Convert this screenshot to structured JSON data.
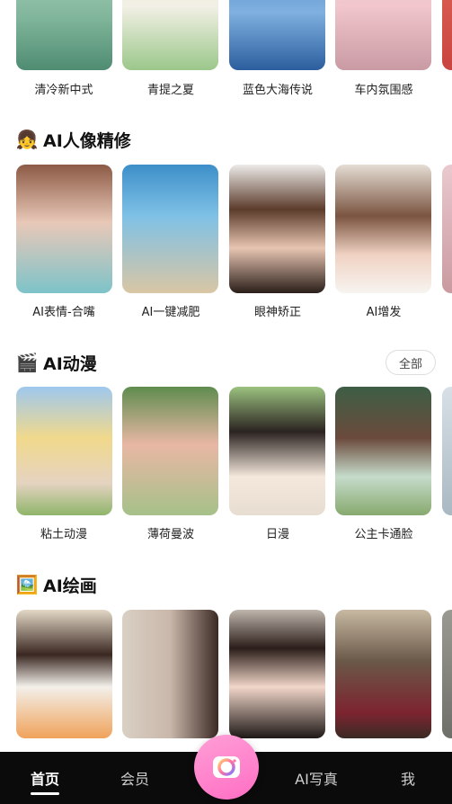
{
  "sections": [
    {
      "title": "",
      "cards": [
        {
          "label": "清冷新中式",
          "gradient": "linear-gradient(180deg,#b9d9c8 0%,#7fb59a 60%,#4f8c72 100%)"
        },
        {
          "label": "青提之夏",
          "gradient": "linear-gradient(180deg,#cfe7b5 0%,#f3f0e6 50%,#9bc78a 100%)"
        },
        {
          "label": "蓝色大海传说",
          "gradient": "linear-gradient(180deg,#4a7fc1 0%,#7fb0e0 55%,#2c5e9e 100%)"
        },
        {
          "label": "车内氛围感",
          "gradient": "linear-gradient(180deg,#e9d3cf 0%,#f1c6cc 50%,#c99aa3 100%)"
        }
      ]
    },
    {
      "title": "AI人像精修",
      "emoji": "👧",
      "cards": [
        {
          "label": "AI表情-合嘴",
          "gradient": "linear-gradient(180deg,#8c5a45 0%,#e9c8b8 45%,#7dc3c9 100%)"
        },
        {
          "label": "AI一键减肥",
          "gradient": "linear-gradient(180deg,#3d8fc9 0%,#7fc1e6 40%,#d9c6a4 100%)"
        },
        {
          "label": "眼神矫正",
          "gradient": "linear-gradient(180deg,#eceae8 0%,#5b3b2a 35%,#e7c5b2 65%,#2a1e19 100%)"
        },
        {
          "label": "AI增发",
          "gradient": "linear-gradient(180deg,#e5ddd4 0%,#7a5440 40%,#f0d2c3 70%,#f7f4f0 100%)"
        }
      ]
    },
    {
      "title": "AI动漫",
      "emoji": "🎬",
      "all_label": "全部",
      "cards": [
        {
          "label": "粘土动漫",
          "gradient": "linear-gradient(180deg,#9fc8ee 0%,#f1d98c 40%,#e5d3c1 75%,#8fb56a 100%)"
        },
        {
          "label": "薄荷曼波",
          "gradient": "linear-gradient(180deg,#5f8c4e 0%,#e8b7a4 45%,#a6c189 100%)"
        },
        {
          "label": "日漫",
          "gradient": "linear-gradient(180deg,#9bc27f 0%,#2b2321 35%,#f4e8dc 70%,#e7ddd0 100%)"
        },
        {
          "label": "公主卡通脸",
          "gradient": "linear-gradient(180deg,#3d5e45 0%,#6b4a3c 40%,#c6dccb 70%,#87a96e 100%)"
        }
      ]
    },
    {
      "title": "AI绘画",
      "emoji": "🖼️",
      "cards": [
        {
          "label": "",
          "gradient": "linear-gradient(180deg,#e3d8c6 0%,#3a2721 35%,#f3f0ea 60%,#f0a25a 100%)"
        },
        {
          "label": "",
          "gradient": "linear-gradient(90deg,#d9d0c4 0%,#c9b7aa 50%,#3b2a24 100%)"
        },
        {
          "label": "",
          "gradient": "linear-gradient(180deg,#bfb6ad 0%,#2b1d19 30%,#f1d6c9 60%,#1e1816 100%)"
        },
        {
          "label": "",
          "gradient": "linear-gradient(180deg,#c7b9a2 0%,#6a5848 40%,#7d2430 80%,#3a2a24 100%)"
        }
      ]
    }
  ],
  "peek_gradients": [
    "linear-gradient(180deg,#e26a5b,#c9453f)",
    "linear-gradient(180deg,#e9c9cf,#c99aa0)",
    "linear-gradient(180deg,#d8e0e6,#a9b8c2)",
    "linear-gradient(180deg,#9a9a92,#6f6f69)"
  ],
  "bottom_nav": {
    "items": [
      {
        "label": "首页",
        "active": true
      },
      {
        "label": "会员",
        "active": false
      },
      {
        "label": "AI写真",
        "active": false
      },
      {
        "label": "我",
        "active": false
      }
    ],
    "center_icon": "camera-icon"
  }
}
